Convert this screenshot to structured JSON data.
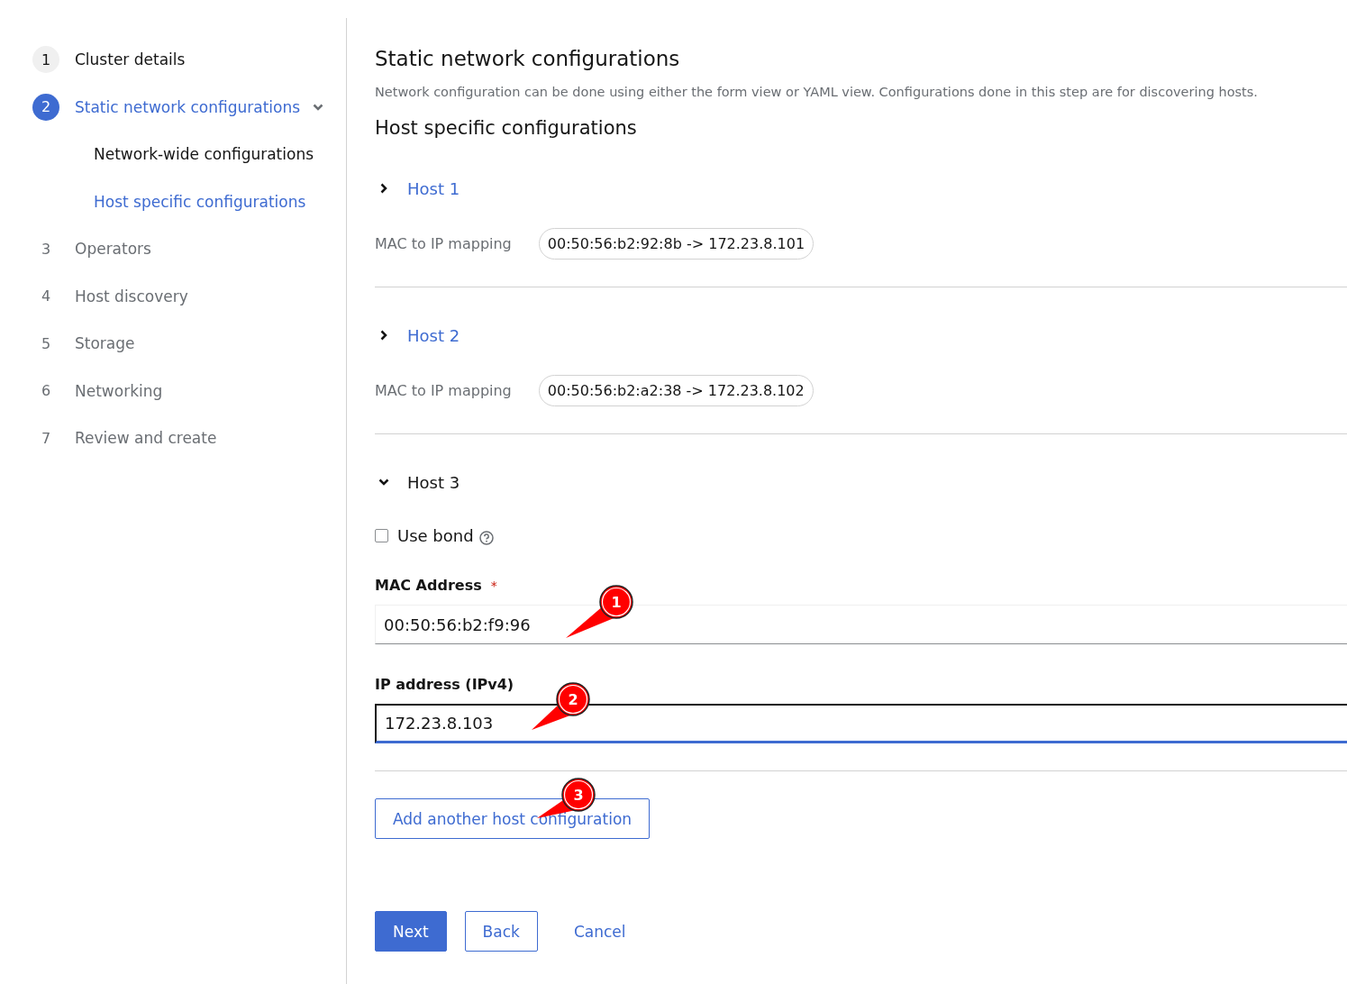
{
  "wizard_nav": {
    "steps": [
      {
        "number": "1",
        "label": "Cluster details",
        "visited": true,
        "selected": false
      },
      {
        "number": "2",
        "label": "Static network configurations",
        "selected": true,
        "expanded": true,
        "children": [
          {
            "label": "Network-wide configurations",
            "selected": false
          },
          {
            "label": "Host specific configurations",
            "selected": true
          }
        ]
      },
      {
        "number": "3",
        "label": "Operators",
        "visited": false,
        "selected": false
      },
      {
        "number": "4",
        "label": "Host discovery",
        "visited": false,
        "selected": false
      },
      {
        "number": "5",
        "label": "Storage",
        "visited": false,
        "selected": false
      },
      {
        "number": "6",
        "label": "Networking",
        "visited": false,
        "selected": false
      },
      {
        "number": "7",
        "label": "Review and create",
        "visited": false,
        "selected": false
      }
    ]
  },
  "page": {
    "title": "Static network configurations",
    "description": "Network configuration can be done using either the form view or YAML view. Configurations done in this step are for discovering hosts.",
    "section_title": "Host specific configurations"
  },
  "hosts": [
    {
      "title": "Host 1",
      "expanded": false,
      "mapping_label": "MAC to IP mapping",
      "mapping": "00:50:56:b2:92:8b -> 172.23.8.101"
    },
    {
      "title": "Host 2",
      "expanded": false,
      "mapping_label": "MAC to IP mapping",
      "mapping": "00:50:56:b2:a2:38 -> 172.23.8.102"
    },
    {
      "title": "Host 3",
      "expanded": true
    }
  ],
  "host_form": {
    "use_bond": {
      "label": "Use bond",
      "checked": false
    },
    "mac": {
      "label": "MAC Address",
      "required_mark": "*",
      "value": "00:50:56:b2:f9:96",
      "focused": false
    },
    "ip": {
      "label": "IP address (IPv4)",
      "value": "172.23.8.103",
      "focused": true
    }
  },
  "add_button": "Add another host configuration",
  "footer": {
    "buttons": [
      {
        "label": "Next",
        "kind": "primary"
      },
      {
        "label": "Back",
        "kind": "secondary"
      },
      {
        "label": "Cancel",
        "kind": "link"
      }
    ]
  },
  "callouts": [
    {
      "label": "1"
    },
    {
      "label": "2"
    },
    {
      "label": "3"
    }
  ]
}
